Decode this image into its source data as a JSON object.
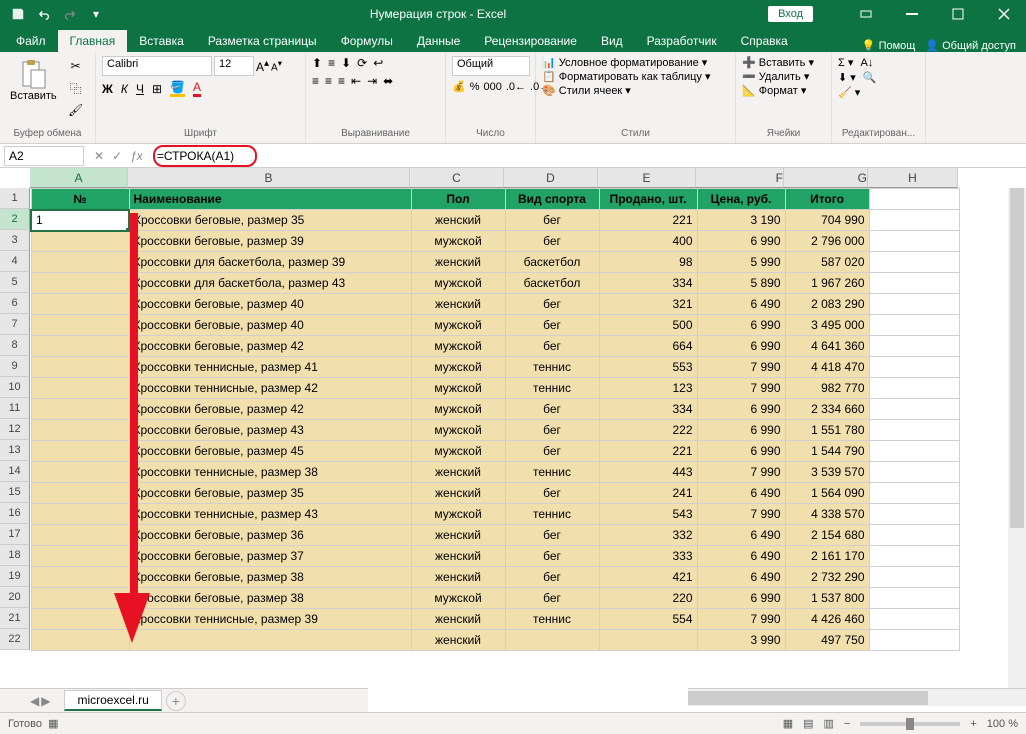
{
  "title": "Нумерация строк  -  Excel",
  "login": "Вход",
  "tabs": {
    "file": "Файл",
    "home": "Главная",
    "insert": "Вставка",
    "layout": "Разметка страницы",
    "formulas": "Формулы",
    "data": "Данные",
    "review": "Рецензирование",
    "view": "Вид",
    "dev": "Разработчик",
    "help": "Справка",
    "tell": "Помощ",
    "share": "Общий доступ"
  },
  "ribbon": {
    "clipboard": "Буфер обмена",
    "paste": "Вставить",
    "font": "Шрифт",
    "fontname": "Calibri",
    "fontsize": "12",
    "align": "Выравнивание",
    "number": "Число",
    "numfmt": "Общий",
    "styles": "Стили",
    "condfmt": "Условное форматирование",
    "tablefmt": "Форматировать как таблицу",
    "cellstyles": "Стили ячеек",
    "cells": "Ячейки",
    "insert": "Вставить",
    "delete": "Удалить",
    "format": "Формат",
    "editing": "Редактирован..."
  },
  "namebox": "A2",
  "formula": "=СТРОКА(A1)",
  "columns": [
    "A",
    "B",
    "C",
    "D",
    "E",
    "F",
    "G",
    "H"
  ],
  "headers": {
    "A": "№",
    "B": "Наименование",
    "C": "Пол",
    "D": "Вид спорта",
    "E": "Продано, шт.",
    "F": "Цена, руб.",
    "G": "Итого"
  },
  "rows": [
    {
      "n": "1",
      "name": "Кроссовки беговые, размер 35",
      "sex": "женский",
      "sport": "бег",
      "sold": "221",
      "price": "3 190",
      "total": "704 990"
    },
    {
      "n": "",
      "name": "Кроссовки беговые, размер 39",
      "sex": "мужской",
      "sport": "бег",
      "sold": "400",
      "price": "6 990",
      "total": "2 796 000"
    },
    {
      "n": "",
      "name": "Кроссовки для баскетбола, размер 39",
      "sex": "женский",
      "sport": "баскетбол",
      "sold": "98",
      "price": "5 990",
      "total": "587 020"
    },
    {
      "n": "",
      "name": "Кроссовки для баскетбола, размер 43",
      "sex": "мужской",
      "sport": "баскетбол",
      "sold": "334",
      "price": "5 890",
      "total": "1 967 260"
    },
    {
      "n": "",
      "name": "Кроссовки беговые, размер 40",
      "sex": "женский",
      "sport": "бег",
      "sold": "321",
      "price": "6 490",
      "total": "2 083 290"
    },
    {
      "n": "",
      "name": "Кроссовки беговые, размер 40",
      "sex": "мужской",
      "sport": "бег",
      "sold": "500",
      "price": "6 990",
      "total": "3 495 000"
    },
    {
      "n": "",
      "name": "Кроссовки беговые, размер 42",
      "sex": "мужской",
      "sport": "бег",
      "sold": "664",
      "price": "6 990",
      "total": "4 641 360"
    },
    {
      "n": "",
      "name": "Кроссовки теннисные, размер 41",
      "sex": "мужской",
      "sport": "теннис",
      "sold": "553",
      "price": "7 990",
      "total": "4 418 470"
    },
    {
      "n": "",
      "name": "Кроссовки теннисные, размер 42",
      "sex": "мужской",
      "sport": "теннис",
      "sold": "123",
      "price": "7 990",
      "total": "982 770"
    },
    {
      "n": "",
      "name": "Кроссовки беговые, размер 42",
      "sex": "мужской",
      "sport": "бег",
      "sold": "334",
      "price": "6 990",
      "total": "2 334 660"
    },
    {
      "n": "",
      "name": "Кроссовки беговые, размер 43",
      "sex": "мужской",
      "sport": "бег",
      "sold": "222",
      "price": "6 990",
      "total": "1 551 780"
    },
    {
      "n": "",
      "name": "Кроссовки беговые, размер 45",
      "sex": "мужской",
      "sport": "бег",
      "sold": "221",
      "price": "6 990",
      "total": "1 544 790"
    },
    {
      "n": "",
      "name": "Кроссовки теннисные, размер 38",
      "sex": "женский",
      "sport": "теннис",
      "sold": "443",
      "price": "7 990",
      "total": "3 539 570"
    },
    {
      "n": "",
      "name": "Кроссовки беговые, размер 35",
      "sex": "женский",
      "sport": "бег",
      "sold": "241",
      "price": "6 490",
      "total": "1 564 090"
    },
    {
      "n": "",
      "name": "Кроссовки теннисные, размер 43",
      "sex": "мужской",
      "sport": "теннис",
      "sold": "543",
      "price": "7 990",
      "total": "4 338 570"
    },
    {
      "n": "",
      "name": "Кроссовки беговые, размер 36",
      "sex": "женский",
      "sport": "бег",
      "sold": "332",
      "price": "6 490",
      "total": "2 154 680"
    },
    {
      "n": "",
      "name": "Кроссовки беговые, размер 37",
      "sex": "женский",
      "sport": "бег",
      "sold": "333",
      "price": "6 490",
      "total": "2 161 170"
    },
    {
      "n": "",
      "name": "Кроссовки беговые, размер 38",
      "sex": "женский",
      "sport": "бег",
      "sold": "421",
      "price": "6 490",
      "total": "2 732 290"
    },
    {
      "n": "",
      "name": "Кроссовки беговые, размер 38",
      "sex": "мужской",
      "sport": "бег",
      "sold": "220",
      "price": "6 990",
      "total": "1 537 800"
    },
    {
      "n": "",
      "name": "Кроссовки теннисные, размер 39",
      "sex": "женский",
      "sport": "теннис",
      "sold": "554",
      "price": "7 990",
      "total": "4 426 460"
    }
  ],
  "sheet_tab": "microexcel.ru",
  "status": "Готово",
  "zoom": "100 %"
}
